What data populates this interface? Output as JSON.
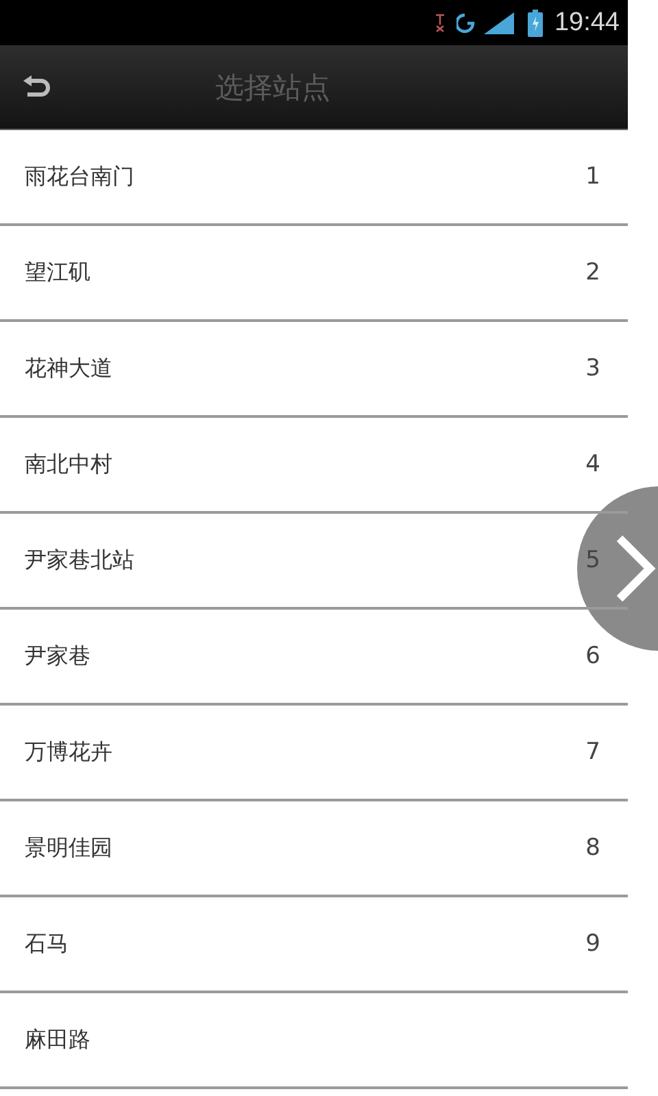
{
  "status_bar": {
    "time": "19:44"
  },
  "header": {
    "title": "选择站点"
  },
  "stations": [
    {
      "name": "雨花台南门",
      "number": "1"
    },
    {
      "name": "望江矶",
      "number": "2"
    },
    {
      "name": "花神大道",
      "number": "3"
    },
    {
      "name": "南北中村",
      "number": "4"
    },
    {
      "name": "尹家巷北站",
      "number": "5"
    },
    {
      "name": "尹家巷",
      "number": "6"
    },
    {
      "name": "万博花卉",
      "number": "7"
    },
    {
      "name": "景明佳园",
      "number": "8"
    },
    {
      "name": "石马",
      "number": "9"
    },
    {
      "name": "麻田路"
    }
  ]
}
